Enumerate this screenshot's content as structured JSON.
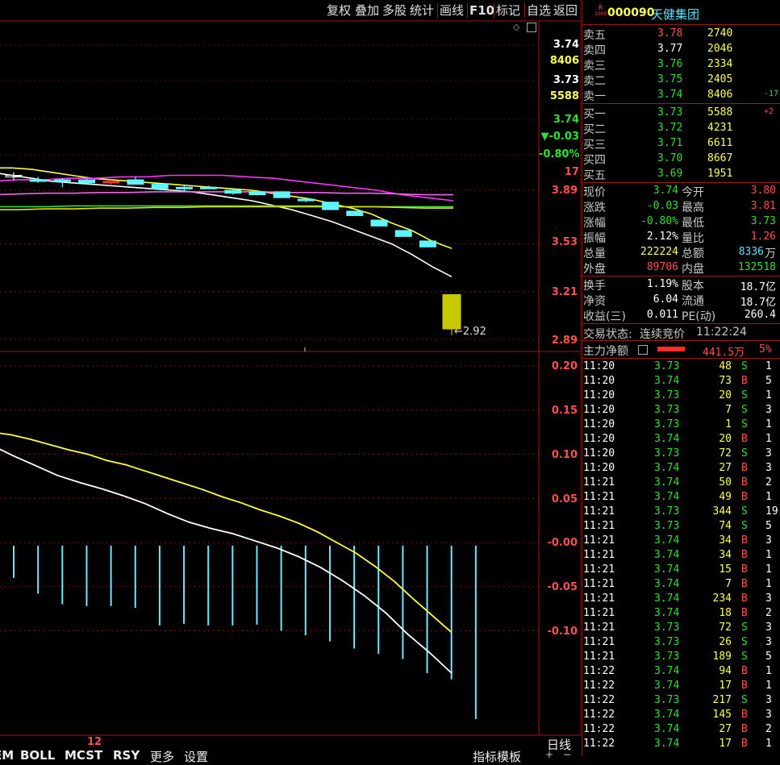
{
  "toolbar": {
    "items": [
      "复权",
      "叠加",
      "多股",
      "统计",
      "画线",
      "F10",
      "标记",
      "自选",
      "返回"
    ]
  },
  "main_axis": {
    "ticks": [
      "3.89",
      "3.53",
      "3.21",
      "2.89"
    ],
    "min_label": "2.92"
  },
  "info_box": {
    "price_a": "3.74",
    "vol_a": "8406",
    "price_b": "3.73",
    "vol_b": "5588",
    "last": "3.74",
    "change": "▼-0.03",
    "pct": "-0.80%",
    "count": "17"
  },
  "sub_axis": {
    "ticks": [
      "0.20",
      "0.15",
      "0.10",
      "0.05",
      "-0.00",
      "-0.05",
      "-0.10"
    ]
  },
  "bottom": {
    "cursor_label": "12",
    "tabs": [
      "EM",
      "BOLL",
      "MCST",
      "RSY",
      "更多",
      "设置"
    ],
    "right_label": "指标模板",
    "period": "日线"
  },
  "stock": {
    "badge_top": "R",
    "badge_bottom": "1000",
    "code": "000090",
    "name": "天健集团"
  },
  "asks": [
    {
      "label": "卖五",
      "price": "3.78",
      "vol": "2740",
      "delta": ""
    },
    {
      "label": "卖四",
      "price": "3.77",
      "vol": "2046",
      "delta": ""
    },
    {
      "label": "卖三",
      "price": "3.76",
      "vol": "2334",
      "delta": ""
    },
    {
      "label": "卖二",
      "price": "3.75",
      "vol": "2405",
      "delta": ""
    },
    {
      "label": "卖一",
      "price": "3.74",
      "vol": "8406",
      "delta": "-17"
    }
  ],
  "bids": [
    {
      "label": "买一",
      "price": "3.73",
      "vol": "5588",
      "delta": "+2"
    },
    {
      "label": "买二",
      "price": "3.72",
      "vol": "4231",
      "delta": ""
    },
    {
      "label": "买三",
      "price": "3.71",
      "vol": "6611",
      "delta": ""
    },
    {
      "label": "买四",
      "price": "3.70",
      "vol": "8667",
      "delta": ""
    },
    {
      "label": "买五",
      "price": "3.69",
      "vol": "1951",
      "delta": ""
    }
  ],
  "stats1": [
    {
      "l1": "现价",
      "v1": "3.74",
      "l2": "今开",
      "v2": "3.80"
    },
    {
      "l1": "涨跌",
      "v1": "-0.03",
      "l2": "最高",
      "v2": "3.81"
    },
    {
      "l1": "涨幅",
      "v1": "-0.80%",
      "l2": "最低",
      "v2": "3.73"
    },
    {
      "l1": "振幅",
      "v1": "2.12%",
      "l2": "量比",
      "v2": "1.26"
    },
    {
      "l1": "总量",
      "v1": "222224",
      "l2": "总额",
      "v2": "8336",
      "v2_unit": "万"
    },
    {
      "l1": "外盘",
      "v1": "89706",
      "l2": "内盘",
      "v2": "132518"
    }
  ],
  "stats2": [
    {
      "l1": "换手",
      "v1": "1.19%",
      "l2": "股本",
      "v2": "18.7亿"
    },
    {
      "l1": "净资",
      "v1": "6.04",
      "l2": "流通",
      "v2": "18.7亿"
    },
    {
      "l1": "收益(三)",
      "v1": "0.011",
      "l2": "PE(动)",
      "v2": "260.4"
    }
  ],
  "trade_status": {
    "label": "交易状态:",
    "value": "连续竞价",
    "time": "11:22:24"
  },
  "capital": {
    "label": "主力净额",
    "value": "441.5万",
    "pct": "5%"
  },
  "ticks": [
    {
      "t": "11:20",
      "p": "3.73",
      "v": "48",
      "d": "S",
      "n": "1"
    },
    {
      "t": "11:20",
      "p": "3.74",
      "v": "73",
      "d": "B",
      "n": "5"
    },
    {
      "t": "11:20",
      "p": "3.73",
      "v": "20",
      "d": "S",
      "n": "1"
    },
    {
      "t": "11:20",
      "p": "3.73",
      "v": "7",
      "d": "S",
      "n": "3"
    },
    {
      "t": "11:20",
      "p": "3.73",
      "v": "1",
      "d": "S",
      "n": "1"
    },
    {
      "t": "11:20",
      "p": "3.74",
      "v": "20",
      "d": "B",
      "n": "1"
    },
    {
      "t": "11:20",
      "p": "3.73",
      "v": "72",
      "d": "S",
      "n": "3"
    },
    {
      "t": "11:20",
      "p": "3.74",
      "v": "27",
      "d": "B",
      "n": "3"
    },
    {
      "t": "11:21",
      "p": "3.74",
      "v": "50",
      "d": "B",
      "n": "2"
    },
    {
      "t": "11:21",
      "p": "3.74",
      "v": "49",
      "d": "B",
      "n": "1"
    },
    {
      "t": "11:21",
      "p": "3.73",
      "v": "344",
      "d": "S",
      "n": "19"
    },
    {
      "t": "11:21",
      "p": "3.73",
      "v": "74",
      "d": "S",
      "n": "5"
    },
    {
      "t": "11:21",
      "p": "3.74",
      "v": "34",
      "d": "B",
      "n": "3"
    },
    {
      "t": "11:21",
      "p": "3.74",
      "v": "34",
      "d": "B",
      "n": "1"
    },
    {
      "t": "11:21",
      "p": "3.74",
      "v": "15",
      "d": "B",
      "n": "1"
    },
    {
      "t": "11:21",
      "p": "3.74",
      "v": "7",
      "d": "B",
      "n": "1"
    },
    {
      "t": "11:21",
      "p": "3.74",
      "v": "234",
      "d": "B",
      "n": "3"
    },
    {
      "t": "11:21",
      "p": "3.74",
      "v": "18",
      "d": "B",
      "n": "2"
    },
    {
      "t": "11:21",
      "p": "3.73",
      "v": "72",
      "d": "S",
      "n": "3"
    },
    {
      "t": "11:21",
      "p": "3.73",
      "v": "26",
      "d": "S",
      "n": "3"
    },
    {
      "t": "11:21",
      "p": "3.73",
      "v": "189",
      "d": "S",
      "n": "5"
    },
    {
      "t": "11:22",
      "p": "3.74",
      "v": "94",
      "d": "B",
      "n": "1"
    },
    {
      "t": "11:22",
      "p": "3.74",
      "v": "17",
      "d": "B",
      "n": "1"
    },
    {
      "t": "11:22",
      "p": "3.73",
      "v": "217",
      "d": "S",
      "n": "3"
    },
    {
      "t": "11:22",
      "p": "3.74",
      "v": "145",
      "d": "B",
      "n": "3"
    },
    {
      "t": "11:22",
      "p": "3.74",
      "v": "27",
      "d": "B",
      "n": "2"
    },
    {
      "t": "11:22",
      "p": "3.74",
      "v": "17",
      "d": "B",
      "n": "1"
    }
  ],
  "candles": [
    {
      "o": 3.99,
      "c": 3.98,
      "h": 4.01,
      "l": 3.96
    },
    {
      "o": 3.96,
      "c": 3.95,
      "h": 3.98,
      "l": 3.94
    },
    {
      "o": 3.96,
      "c": 3.95,
      "h": 3.97,
      "l": 3.91
    },
    {
      "o": 3.96,
      "c": 3.94,
      "h": 3.97,
      "l": 3.94
    },
    {
      "o": 3.95,
      "c": 3.95,
      "h": 3.96,
      "l": 3.92
    },
    {
      "o": 3.96,
      "c": 3.93,
      "h": 3.98,
      "l": 3.93
    },
    {
      "o": 3.93,
      "c": 3.9,
      "h": 3.93,
      "l": 3.89
    },
    {
      "o": 3.91,
      "c": 3.9,
      "h": 3.92,
      "l": 3.88
    },
    {
      "o": 3.91,
      "c": 3.9,
      "h": 3.92,
      "l": 3.9
    },
    {
      "o": 3.89,
      "c": 3.87,
      "h": 3.9,
      "l": 3.86
    },
    {
      "o": 3.88,
      "c": 3.86,
      "h": 3.89,
      "l": 3.86
    },
    {
      "o": 3.88,
      "c": 3.84,
      "h": 3.88,
      "l": 3.84
    },
    {
      "o": 3.83,
      "c": 3.82,
      "h": 3.84,
      "l": 3.81
    },
    {
      "o": 3.81,
      "c": 3.76,
      "h": 3.81,
      "l": 3.76
    },
    {
      "o": 3.75,
      "c": 3.72,
      "h": 3.75,
      "l": 3.72
    },
    {
      "o": 3.69,
      "c": 3.65,
      "h": 3.69,
      "l": 3.65
    },
    {
      "o": 3.62,
      "c": 3.58,
      "h": 3.62,
      "l": 3.58
    },
    {
      "o": 3.55,
      "c": 3.51,
      "h": 3.55,
      "l": 3.51
    },
    {
      "o": 3.19,
      "c": 2.96,
      "h": 3.19,
      "l": 2.92
    }
  ],
  "ma": [
    {
      "color": "#ffffff",
      "values": [
        4.01,
        3.99,
        3.97,
        3.95,
        3.94,
        3.93,
        3.92,
        3.91,
        3.9,
        3.89,
        3.88,
        3.86,
        3.84,
        3.82,
        3.79,
        3.76,
        3.72,
        3.68,
        3.63,
        3.58,
        3.53,
        3.46,
        3.38,
        3.31
      ]
    },
    {
      "color": "#ffff44",
      "values": [
        4.04,
        4.04,
        4.03,
        4.01,
        3.99,
        3.97,
        3.96,
        3.95,
        3.94,
        3.93,
        3.92,
        3.91,
        3.9,
        3.89,
        3.87,
        3.85,
        3.83,
        3.8,
        3.77,
        3.73,
        3.67,
        3.62,
        3.55,
        3.5
      ]
    },
    {
      "color": "#ff33ff",
      "values": [
        3.95,
        3.96,
        3.96,
        3.97,
        3.97,
        3.98,
        3.98,
        3.99,
        3.99,
        3.99,
        3.98,
        3.97,
        3.95,
        3.93,
        3.91,
        3.89,
        3.86,
        3.84,
        3.82
      ]
    },
    {
      "color": "#ee66ee",
      "values": [
        3.86,
        3.865,
        3.87,
        3.87,
        3.875,
        3.875,
        3.88,
        3.88,
        3.88,
        3.88,
        3.88,
        3.875,
        3.875,
        3.87,
        3.87,
        3.865,
        3.86,
        3.86
      ]
    },
    {
      "color": "#33dd33",
      "values": [
        3.78,
        3.78,
        3.78,
        3.785,
        3.785,
        3.785,
        3.785,
        3.785,
        3.785,
        3.785,
        3.785,
        3.785,
        3.785,
        3.78,
        3.78,
        3.78,
        3.78,
        3.78
      ]
    },
    {
      "color": "#dddd00",
      "values": [
        3.76,
        3.76,
        3.765,
        3.765,
        3.77,
        3.77,
        3.775,
        3.775,
        3.78,
        3.78,
        3.78,
        3.78,
        3.78,
        3.78,
        3.78,
        3.775,
        3.77,
        3.77
      ]
    }
  ],
  "macd": {
    "dif": [
      0.11,
      0.098,
      0.087,
      0.076,
      0.068,
      0.061,
      0.053,
      0.044,
      0.033,
      0.023,
      0.016,
      0.01,
      0.002,
      -0.006,
      -0.016,
      -0.028,
      -0.043,
      -0.06,
      -0.08,
      -0.104,
      -0.125,
      -0.148
    ],
    "dea": [
      0.125,
      0.122,
      0.117,
      0.111,
      0.105,
      0.1,
      0.093,
      0.088,
      0.081,
      0.074,
      0.067,
      0.06,
      0.052,
      0.045,
      0.037,
      0.03,
      0.022,
      0.012,
      0.0,
      -0.012,
      -0.027,
      -0.044,
      -0.064,
      -0.083,
      -0.102
    ],
    "bars": [
      -0.04,
      -0.058,
      -0.07,
      -0.072,
      -0.072,
      -0.074,
      -0.094,
      -0.092,
      -0.094,
      -0.094,
      -0.093,
      -0.1,
      -0.105,
      -0.112,
      -0.12,
      -0.126,
      -0.132,
      -0.148,
      -0.155,
      -0.2
    ]
  }
}
